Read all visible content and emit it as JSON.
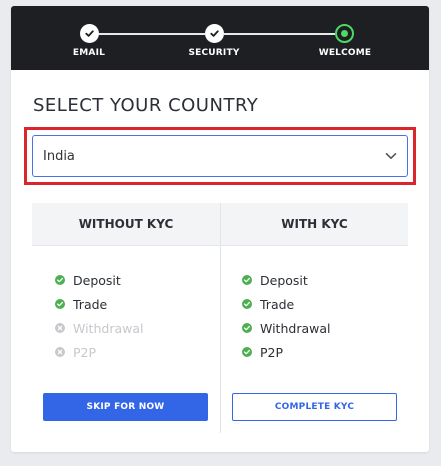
{
  "stepper": {
    "steps": [
      {
        "label": "EMAIL",
        "state": "done"
      },
      {
        "label": "SECURITY",
        "state": "done"
      },
      {
        "label": "WELCOME",
        "state": "current"
      }
    ],
    "colors": {
      "background": "#1d1f23",
      "done": "#ffffff",
      "current": "#4cd964"
    }
  },
  "country": {
    "title": "SELECT YOUR COUNTRY",
    "selected": "India"
  },
  "kyc": {
    "without": {
      "heading": "WITHOUT KYC",
      "features": [
        {
          "label": "Deposit",
          "enabled": true
        },
        {
          "label": "Trade",
          "enabled": true
        },
        {
          "label": "Withdrawal",
          "enabled": false
        },
        {
          "label": "P2P",
          "enabled": false
        }
      ],
      "button_label": "SKIP FOR NOW"
    },
    "with": {
      "heading": "WITH KYC",
      "features": [
        {
          "label": "Deposit",
          "enabled": true
        },
        {
          "label": "Trade",
          "enabled": true
        },
        {
          "label": "Withdrawal",
          "enabled": true
        },
        {
          "label": "P2P",
          "enabled": true
        }
      ],
      "button_label": "COMPLETE KYC"
    }
  },
  "colors": {
    "accent": "#3366e6",
    "check_enabled": "#4caf50",
    "check_disabled": "#c6c8cc",
    "highlight": "#d9252b"
  }
}
